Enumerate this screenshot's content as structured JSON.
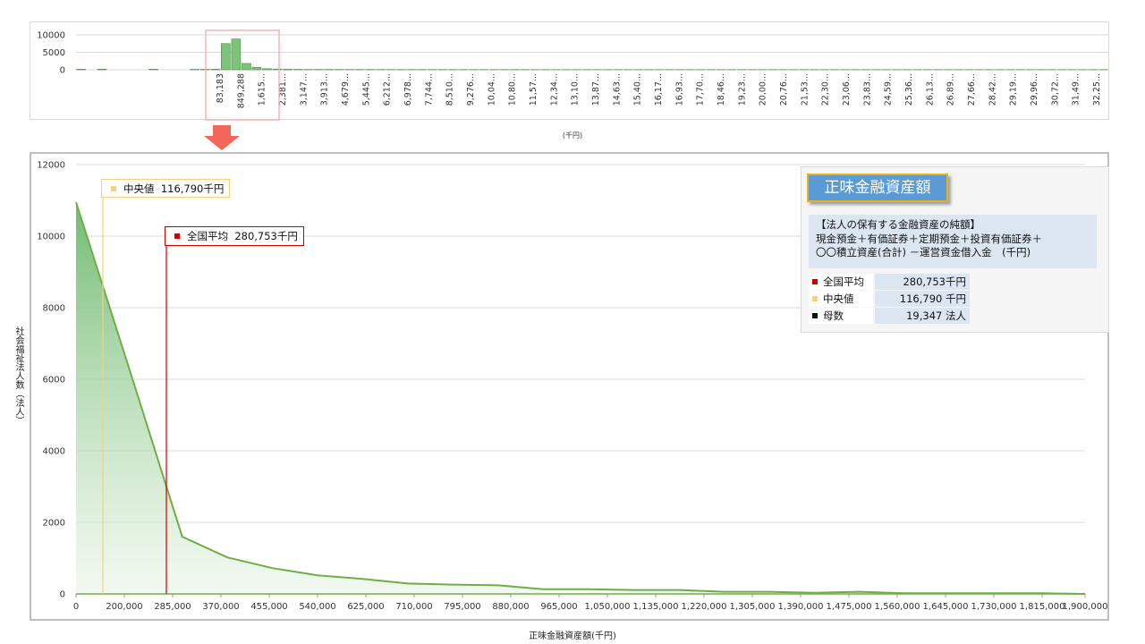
{
  "colors": {
    "fill_top": "#6bb86b",
    "line": "#70ad47",
    "bar_fill": "#7cc47c",
    "bar_stroke": "#4e9a3e",
    "grid": "#d9d9d9",
    "mean": "#cc0000",
    "median": "#f3d27a",
    "count": "#111111",
    "highlight_box": "#f4b6b6",
    "arrow": "#f4655a"
  },
  "overview": {
    "unit_label": "(千円)",
    "y_ticks": [
      "10000",
      "5000",
      "0"
    ],
    "chart_data": {
      "type": "bar",
      "ylim": [
        0,
        10000
      ],
      "x_tick_labels": [
        "83,183",
        "849,288",
        "1,615...",
        "2,381...",
        "3,147...",
        "3,913...",
        "4,679...",
        "5,445...",
        "6,212...",
        "6,978...",
        "7,744...",
        "8,510...",
        "9,276...",
        "10,04...",
        "10,80...",
        "11,57...",
        "12,34...",
        "13,10...",
        "13,87...",
        "14,63...",
        "15,40...",
        "16,17...",
        "16,93...",
        "17,70...",
        "18,46...",
        "19,23...",
        "20,00...",
        "20,76...",
        "21,53...",
        "22,30...",
        "23,06...",
        "23,83...",
        "24,59...",
        "25,36...",
        "26,13...",
        "26,89...",
        "27,66...",
        "28,42...",
        "29,19...",
        "29,96...",
        "30,72...",
        "31,49...",
        "32,25..."
      ],
      "values": [
        150,
        0,
        160,
        0,
        0,
        0,
        0,
        150,
        0,
        0,
        0,
        120,
        130,
        150,
        7500,
        8800,
        1800,
        700,
        300,
        200,
        150,
        120,
        100,
        100,
        90,
        90,
        80,
        80,
        80,
        80,
        70,
        70,
        70,
        70,
        70,
        70,
        60,
        60,
        60,
        60,
        60,
        60,
        60,
        60,
        50,
        50,
        50,
        50,
        50,
        50,
        50,
        50,
        50,
        50,
        50,
        50,
        50,
        50,
        50,
        50,
        50,
        50,
        50,
        50,
        50,
        50,
        50,
        50,
        50,
        50,
        50,
        50,
        50,
        50,
        50,
        50,
        50,
        50,
        50,
        50,
        50,
        50,
        50,
        50,
        50,
        50,
        50,
        50,
        50,
        50,
        50,
        50,
        50,
        50,
        50,
        50,
        50,
        50,
        50,
        50
      ]
    }
  },
  "main": {
    "ylabel": "社会福祉法人数（法人）",
    "xlabel": "正味金融資産額(千円)",
    "chart_data": {
      "type": "area",
      "x": [
        0,
        100000,
        200000,
        285000,
        370000,
        455000,
        540000,
        625000,
        710000,
        795000,
        880000,
        965000,
        1050000,
        1135000,
        1220000,
        1305000,
        1390000,
        1475000,
        1560000,
        1645000,
        1730000,
        1815000,
        1900000
      ],
      "y": [
        10950,
        6300,
        1600,
        1020,
        720,
        520,
        420,
        290,
        260,
        240,
        130,
        130,
        110,
        110,
        60,
        60,
        30,
        60,
        20,
        20,
        20,
        20,
        0
      ],
      "xlim": [
        0,
        1900000
      ],
      "ylim": [
        0,
        12000
      ],
      "x_tick_labels": [
        "0",
        "200,000",
        "285,000",
        "370,000",
        "455,000",
        "540,000",
        "625,000",
        "710,000",
        "795,000",
        "880,000",
        "965,000",
        "1,050,000",
        "1,135,000",
        "1,220,000",
        "1,305,000",
        "1,390,000",
        "1,475,000",
        "1,560,000",
        "1,645,000",
        "1,730,000",
        "1,815,000",
        "1,900,000"
      ],
      "x_tick_values": [
        0,
        115000,
        200000,
        285000,
        370000,
        455000,
        540000,
        625000,
        710000,
        795000,
        880000,
        965000,
        1050000,
        1135000,
        1220000,
        1305000,
        1390000,
        1475000,
        1560000,
        1645000,
        1730000,
        1815000,
        1900000
      ],
      "y_ticks": [
        0,
        2000,
        4000,
        6000,
        8000,
        10000,
        12000
      ],
      "grid": true,
      "median": {
        "label": "中央値",
        "value_text": "116,790千円",
        "value": 116790
      },
      "mean": {
        "label": "全国平均",
        "value_text": "280,753千円",
        "value": 280753
      }
    }
  },
  "info": {
    "title": "正味金融資産額",
    "desc_lines": [
      "【法人の保有する金融資産の純額】",
      "現金預金＋有価証券＋定期預金＋投資有価証券＋",
      "〇〇積立資産(合計) －運営資金借入金　(千円)"
    ],
    "rows": [
      {
        "label": "全国平均",
        "value": "280,753千円",
        "color_key": "mean"
      },
      {
        "label": "中央値",
        "value": "116,790 千円",
        "color_key": "median"
      },
      {
        "label": "母数",
        "value": "19,347 法人",
        "color_key": "count"
      }
    ]
  }
}
